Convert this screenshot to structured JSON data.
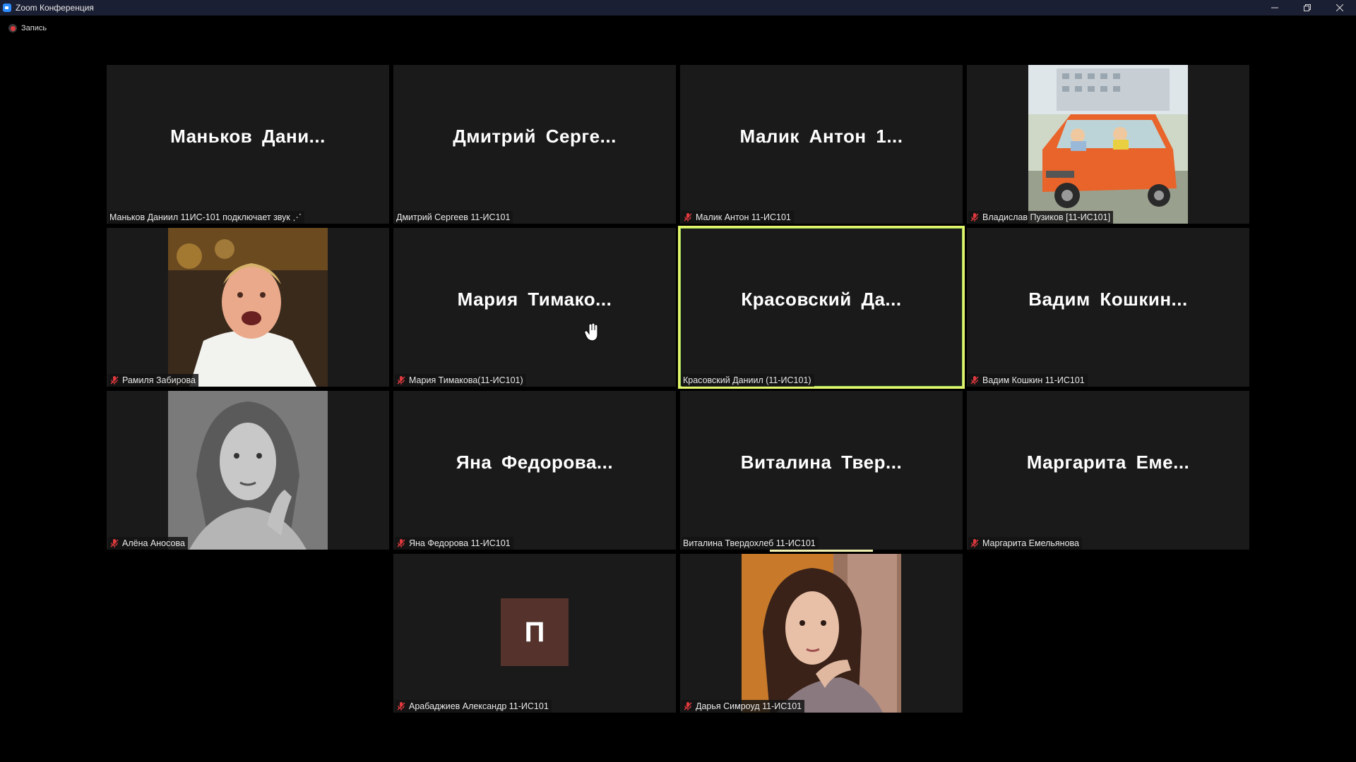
{
  "window": {
    "title": "Zoom Конференция"
  },
  "recording": {
    "label": "Запись"
  },
  "participants": [
    {
      "big": "Маньков Дани...",
      "label": "Маньков Даниил 11ИС-101 подключает звук ⋰",
      "muted": false
    },
    {
      "big": "Дмитрий Серге...",
      "label": "Дмитрий Сергеев 11-ИС101",
      "muted": false
    },
    {
      "big": "Малик Антон 1...",
      "label": "Малик Антон 11-ИС101",
      "muted": true
    },
    {
      "big": "",
      "label": "Владислав Пузиков [11-ИС101]",
      "muted": true
    },
    {
      "big": "",
      "label": "Рамиля Забирова",
      "muted": true
    },
    {
      "big": "Мария Тимако...",
      "label": "Мария Тимакова(11-ИС101)",
      "muted": true
    },
    {
      "big": "Красовский Да...",
      "label": "Красовский Даниил (11-ИС101)",
      "muted": false
    },
    {
      "big": "Вадим Кошкин...",
      "label": "Вадим Кошкин 11-ИС101",
      "muted": true
    },
    {
      "big": "",
      "label": "Алёна Аносова",
      "muted": true
    },
    {
      "big": "Яна Федорова...",
      "label": "Яна Федорова 11-ИС101",
      "muted": true
    },
    {
      "big": "Виталина Твер...",
      "label": "Виталина Твердохлеб 11-ИС101",
      "muted": false
    },
    {
      "big": "Маргарита Еме...",
      "label": "Маргарита Емельянова",
      "muted": true
    },
    {
      "big": "П",
      "label": "Арабаджиев Александр 11-ИС101",
      "muted": true
    },
    {
      "big": "",
      "label": "Дарья Симроуд 11-ИС101",
      "muted": true
    }
  ],
  "colors": {
    "active_border": "#e3f56a",
    "muted_mic": "#e0393e",
    "avatar_bg": "#55332c"
  }
}
